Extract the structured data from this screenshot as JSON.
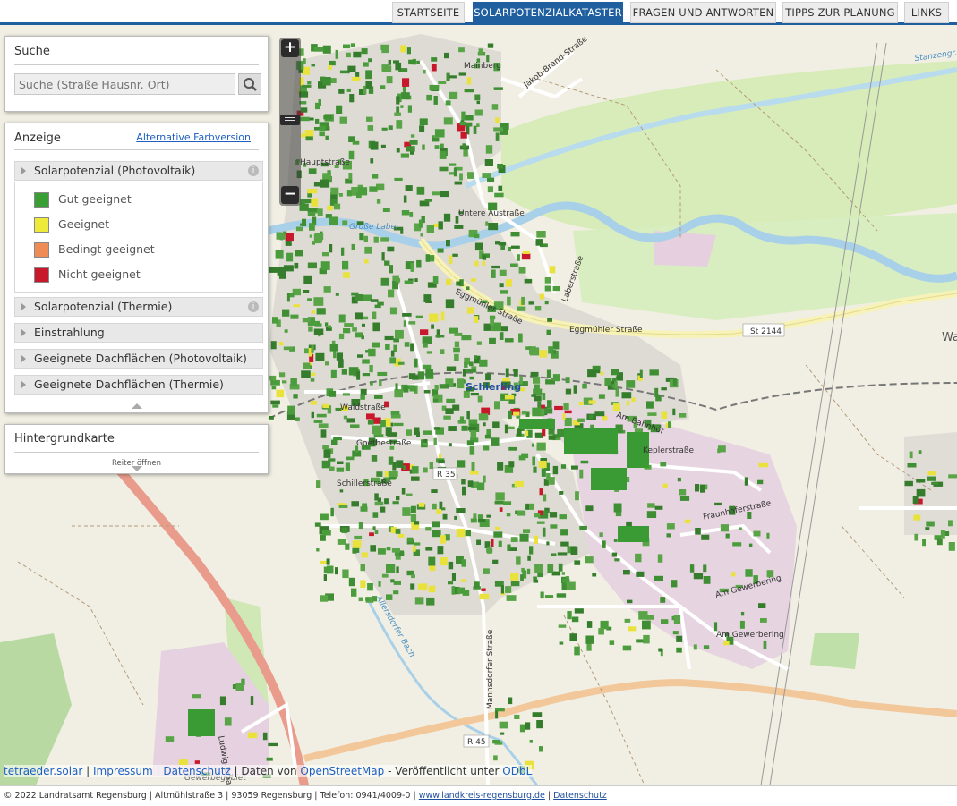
{
  "nav": {
    "tabs": [
      {
        "label": "STARTSEITE",
        "active": false
      },
      {
        "label": "SOLARPOTENZIALKATASTER",
        "active": true
      },
      {
        "label": "FRAGEN UND ANTWORTEN",
        "active": false
      },
      {
        "label": "TIPPS ZUR PLANUNG",
        "active": false
      },
      {
        "label": "LINKS",
        "active": false
      }
    ]
  },
  "zoom": {
    "in_label": "+",
    "out_label": "−"
  },
  "search": {
    "title": "Suche",
    "placeholder": "Suche (Straße Hausnr. Ort)",
    "button_icon": "magnifier-icon"
  },
  "display": {
    "title": "Anzeige",
    "alt_link": "Alternative Farbversion",
    "sections": [
      {
        "label": "Solarpotenzial (Photovoltaik)",
        "info": true,
        "open": true
      },
      {
        "label": "Solarpotenzial (Thermie)",
        "info": true,
        "open": false
      },
      {
        "label": "Einstrahlung",
        "info": false,
        "open": false
      },
      {
        "label": "Geeignete Dachflächen (Photovoltaik)",
        "info": false,
        "open": false
      },
      {
        "label": "Geeignete Dachflächen (Thermie)",
        "info": false,
        "open": false
      }
    ],
    "legend": [
      {
        "label": "Gut geeignet",
        "color": "#3aa035"
      },
      {
        "label": "Geeignet",
        "color": "#eeea3a"
      },
      {
        "label": "Bedingt geeignet",
        "color": "#ef8c56"
      },
      {
        "label": "Nicht geeignet",
        "color": "#c8182c"
      }
    ]
  },
  "background": {
    "title": "Hintergrundkarte",
    "tab_hint": "Reiter öffnen"
  },
  "map": {
    "labels": {
      "hauptstrasse": "Hauptstraße",
      "jakob_brand": "Jakob-Brand-Straße",
      "mainberg": "Mainberg",
      "untere_austrasse": "Untere Austraße",
      "grosse_laber": "Große Laber",
      "schierling": "Schierling",
      "eggmuehler": "Eggmühler Straße",
      "eggmuehler2": "Eggmühler Straße",
      "st2144": "St 2144",
      "waldstrasse": "Waldstraße",
      "goethestrasse": "Goethestraße",
      "schillerstrasse": "Schillerstraße",
      "r35": "R 35",
      "keplerstrasse": "Keplerstraße",
      "am_gewerbering": "Am Gewerbering",
      "am_gewerbering2": "Am Gewerbering",
      "fraunhoferstrasse": "Fraunhoferstraße",
      "allersdorfer_bach": "Allersdorfer Bach",
      "mannsdorfer": "Mannsdorfer Straße",
      "r45": "R 45",
      "ludwig_erhard": "Ludwig-Erhard-Straße",
      "gewerbegebiet": "Gewerbegebiet",
      "laberstrasse": "Laberstraße",
      "am_bahnhof": "Am Bahnhof",
      "wa": "Wa",
      "stanzengr": "Stanzengr..."
    }
  },
  "attribution": {
    "link1": "tetraeder.solar",
    "link2": "Impressum",
    "link3": "Datenschutz",
    "text1": "Daten von",
    "link4": "OpenStreetMap",
    "text2": "- Veröffentlicht unter",
    "link5": "ODbL"
  },
  "footer": {
    "text": "© 2022 Landratsamt Regensburg | Altmühlstraße 3 | 93059 Regensburg | Telefon: 0941/4009-0 |",
    "link1": "www.landkreis-regensburg.de",
    "sep": "|",
    "link2": "Datenschutz"
  }
}
